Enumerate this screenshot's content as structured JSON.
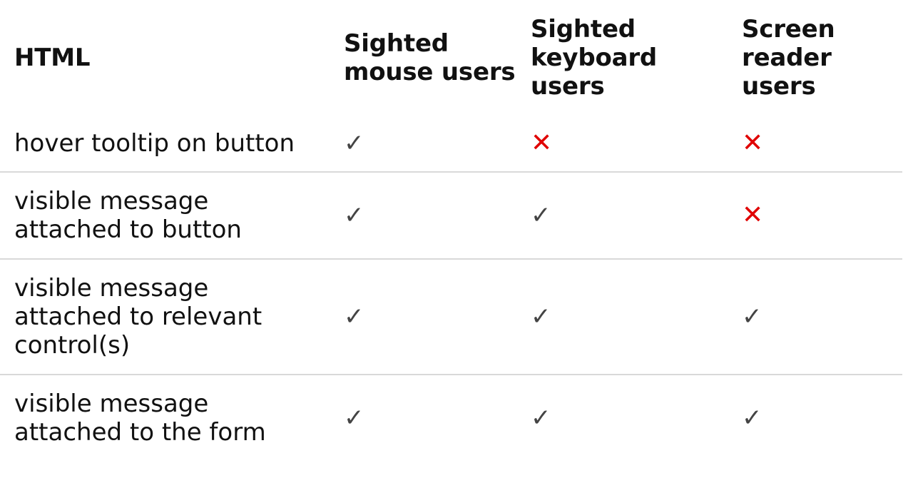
{
  "header": {
    "col_html": "HTML",
    "col_mouse_line1": "Sighted",
    "col_mouse_line2": "mouse users",
    "col_keyboard_line1": "Sighted",
    "col_keyboard_line2": "keyboard",
    "col_keyboard_line3": "users",
    "col_sr_line1": "Screen",
    "col_sr_line2": "reader",
    "col_sr_line3": "users"
  },
  "rows": [
    {
      "label_line1": "hover tooltip on button",
      "label_line2": "",
      "label_line3": "",
      "mouse": "✓",
      "keyboard": "✕",
      "screen_reader": "✕"
    },
    {
      "label_line1": "visible message",
      "label_line2": "attached to button",
      "label_line3": "",
      "mouse": "✓",
      "keyboard": "✓",
      "screen_reader": "✕"
    },
    {
      "label_line1": "visible message",
      "label_line2": "attached to relevant",
      "label_line3": "control(s)",
      "mouse": "✓",
      "keyboard": "✓",
      "screen_reader": "✓"
    },
    {
      "label_line1": "visible message",
      "label_line2": "attached to the form",
      "label_line3": "",
      "mouse": "✓",
      "keyboard": "✓",
      "screen_reader": "✓"
    }
  ],
  "colors": {
    "check": "#444444",
    "cross": "#e00000",
    "divider": "#d9d9d9"
  },
  "icons": {
    "check": "check-icon",
    "cross": "cross-icon"
  }
}
